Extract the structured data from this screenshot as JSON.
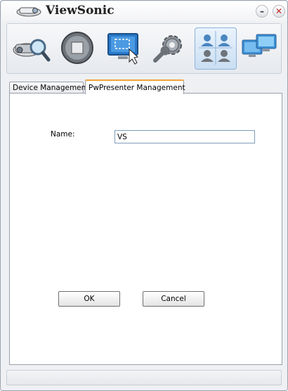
{
  "window": {
    "title": "ViewSonic",
    "min_label": "–",
    "close_label": "✕"
  },
  "toolbar": {
    "items": [
      {
        "icon": "projector-search-icon",
        "active": false
      },
      {
        "icon": "stop-icon",
        "active": false
      },
      {
        "icon": "screen-capture-icon",
        "active": false
      },
      {
        "icon": "settings-icon",
        "active": false
      },
      {
        "icon": "users-grid-icon",
        "active": true
      },
      {
        "icon": "network-displays-icon",
        "active": false
      }
    ]
  },
  "tabs": [
    {
      "label": "Device Management",
      "selected": false
    },
    {
      "label": "PwPresenter Management",
      "selected": true
    }
  ],
  "form": {
    "name_label": "Name:",
    "name_value": "VS"
  },
  "buttons": {
    "ok_label": "OK",
    "cancel_label": "Cancel"
  },
  "colors": {
    "active_tab_accent": "#f0a43a",
    "active_tool_bg": "#c9def2"
  }
}
